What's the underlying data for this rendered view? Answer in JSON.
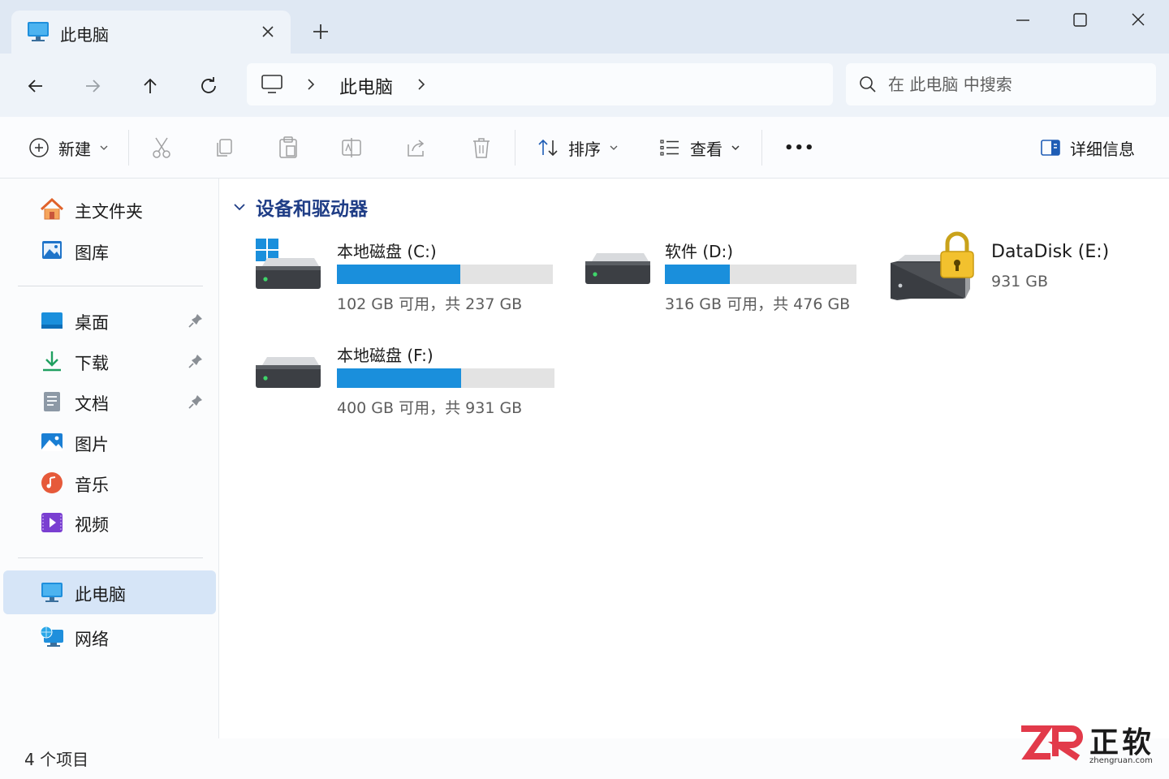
{
  "window": {
    "tab_title": "此电脑",
    "new_tab": "+"
  },
  "nav": {
    "breadcrumb": [
      "此电脑"
    ],
    "search_placeholder": "在 此电脑 中搜索"
  },
  "toolbar": {
    "new_label": "新建",
    "sort_label": "排序",
    "view_label": "查看",
    "more_label": "•••",
    "details_label": "详细信息"
  },
  "sidebar": {
    "top_items": [
      {
        "label": "主文件夹",
        "icon": "home-icon"
      },
      {
        "label": "图库",
        "icon": "gallery-icon"
      }
    ],
    "quick_items": [
      {
        "label": "桌面",
        "icon": "desktop-icon",
        "pinned": true
      },
      {
        "label": "下载",
        "icon": "download-icon",
        "pinned": true
      },
      {
        "label": "文档",
        "icon": "documents-icon",
        "pinned": true
      },
      {
        "label": "图片",
        "icon": "pictures-icon",
        "pinned": false
      },
      {
        "label": "音乐",
        "icon": "music-icon",
        "pinned": false
      },
      {
        "label": "视频",
        "icon": "videos-icon",
        "pinned": false
      }
    ],
    "bottom_items": [
      {
        "label": "此电脑",
        "icon": "this-pc-icon",
        "selected": true
      },
      {
        "label": "网络",
        "icon": "network-icon",
        "selected": false
      }
    ]
  },
  "main": {
    "group_title": "设备和驱动器",
    "drives": [
      {
        "name": "本地磁盘 (C:)",
        "space": "102 GB 可用，共 237 GB",
        "used_fraction": 0.57,
        "system": true
      },
      {
        "name": "软件 (D:)",
        "space": "316 GB 可用，共 476 GB",
        "used_fraction": 0.34,
        "system": false
      },
      {
        "name": "DataDisk (E:)",
        "space": "931 GB",
        "locked": true
      },
      {
        "name": "本地磁盘 (F:)",
        "space": "400 GB 可用，共 931 GB",
        "used_fraction": 0.57,
        "system": false
      }
    ]
  },
  "status": {
    "item_count": "4 个项目"
  },
  "watermark": {
    "brand": "正软",
    "url": "zhengruan.com"
  },
  "colors": {
    "accent": "#1a8fdc",
    "selection": "#d6e5f7",
    "titlebar": "#dfe8f3",
    "group_title": "#1f3d86"
  }
}
